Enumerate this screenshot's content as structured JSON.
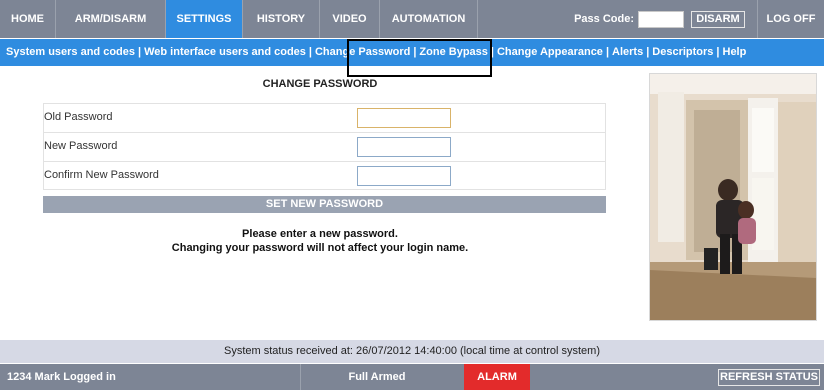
{
  "top_nav": {
    "tabs": [
      {
        "label": "HOME"
      },
      {
        "label": "ARM/DISARM"
      },
      {
        "label": "SETTINGS"
      },
      {
        "label": "HISTORY"
      },
      {
        "label": "VIDEO"
      },
      {
        "label": "AUTOMATION"
      }
    ],
    "active_tab": "SETTINGS",
    "pass_code_label": "Pass Code:",
    "pass_code_value": "",
    "disarm_label": "DISARM",
    "log_off_label": "LOG OFF"
  },
  "sub_nav": {
    "items": [
      {
        "label": "System users and codes"
      },
      {
        "label": "Web interface users and codes"
      },
      {
        "label": "Change Password"
      },
      {
        "label": "Zone Bypass"
      },
      {
        "label": "Change Appearance"
      },
      {
        "label": "Alerts"
      },
      {
        "label": "Descriptors"
      },
      {
        "label": "Help"
      }
    ],
    "separator": "|"
  },
  "form": {
    "title": "CHANGE PASSWORD",
    "fields": [
      {
        "label": "Old Password",
        "value": ""
      },
      {
        "label": "New Password",
        "value": ""
      },
      {
        "label": "Confirm New Password",
        "value": ""
      }
    ],
    "submit_label": "SET NEW PASSWORD"
  },
  "messages": {
    "line1": "Please enter a new password.",
    "line2": "Changing your password will not affect your login name."
  },
  "status_bar": {
    "text": "System status received at: 26/07/2012 14:40:00 (local time at control system)"
  },
  "bottom_bar": {
    "user_status": "1234 Mark Logged in",
    "arm_state": "Full Armed",
    "alarm_label": "ALARM",
    "refresh_label": "REFRESH STATUS"
  },
  "colors": {
    "nav_bg": "#7d8595",
    "accent_blue": "#2f8ce0",
    "alarm_red": "#e32b2b",
    "status_bg": "#d6d9e5"
  }
}
